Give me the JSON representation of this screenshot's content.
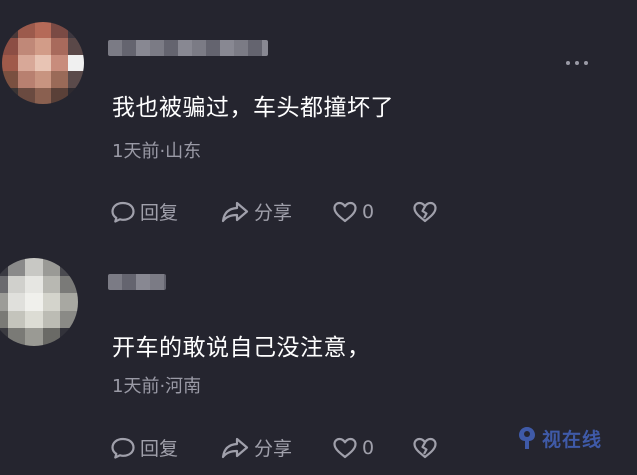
{
  "comments": [
    {
      "text": "我也被骗过，车头都撞坏了",
      "meta": "1天前·山东",
      "reply_label": "回复",
      "share_label": "分享",
      "like_count": "0"
    },
    {
      "text": "开车的敢说自己没注意，",
      "meta": "1天前·河南",
      "reply_label": "回复",
      "share_label": "分享",
      "like_count": "0"
    }
  ],
  "watermark": {
    "text": "视在线",
    "icon": "watermark-logo-icon"
  },
  "icons": {
    "more": "more-dots-icon",
    "reply": "comment-bubble-icon",
    "share": "share-arrow-icon",
    "like": "heart-icon",
    "dislike": "broken-heart-icon"
  },
  "colors": {
    "background": "#25252f",
    "text": "#ffffff",
    "meta_text": "#9a9aa6",
    "action": "#a0a0ab",
    "watermark": "#3f5aa8"
  }
}
